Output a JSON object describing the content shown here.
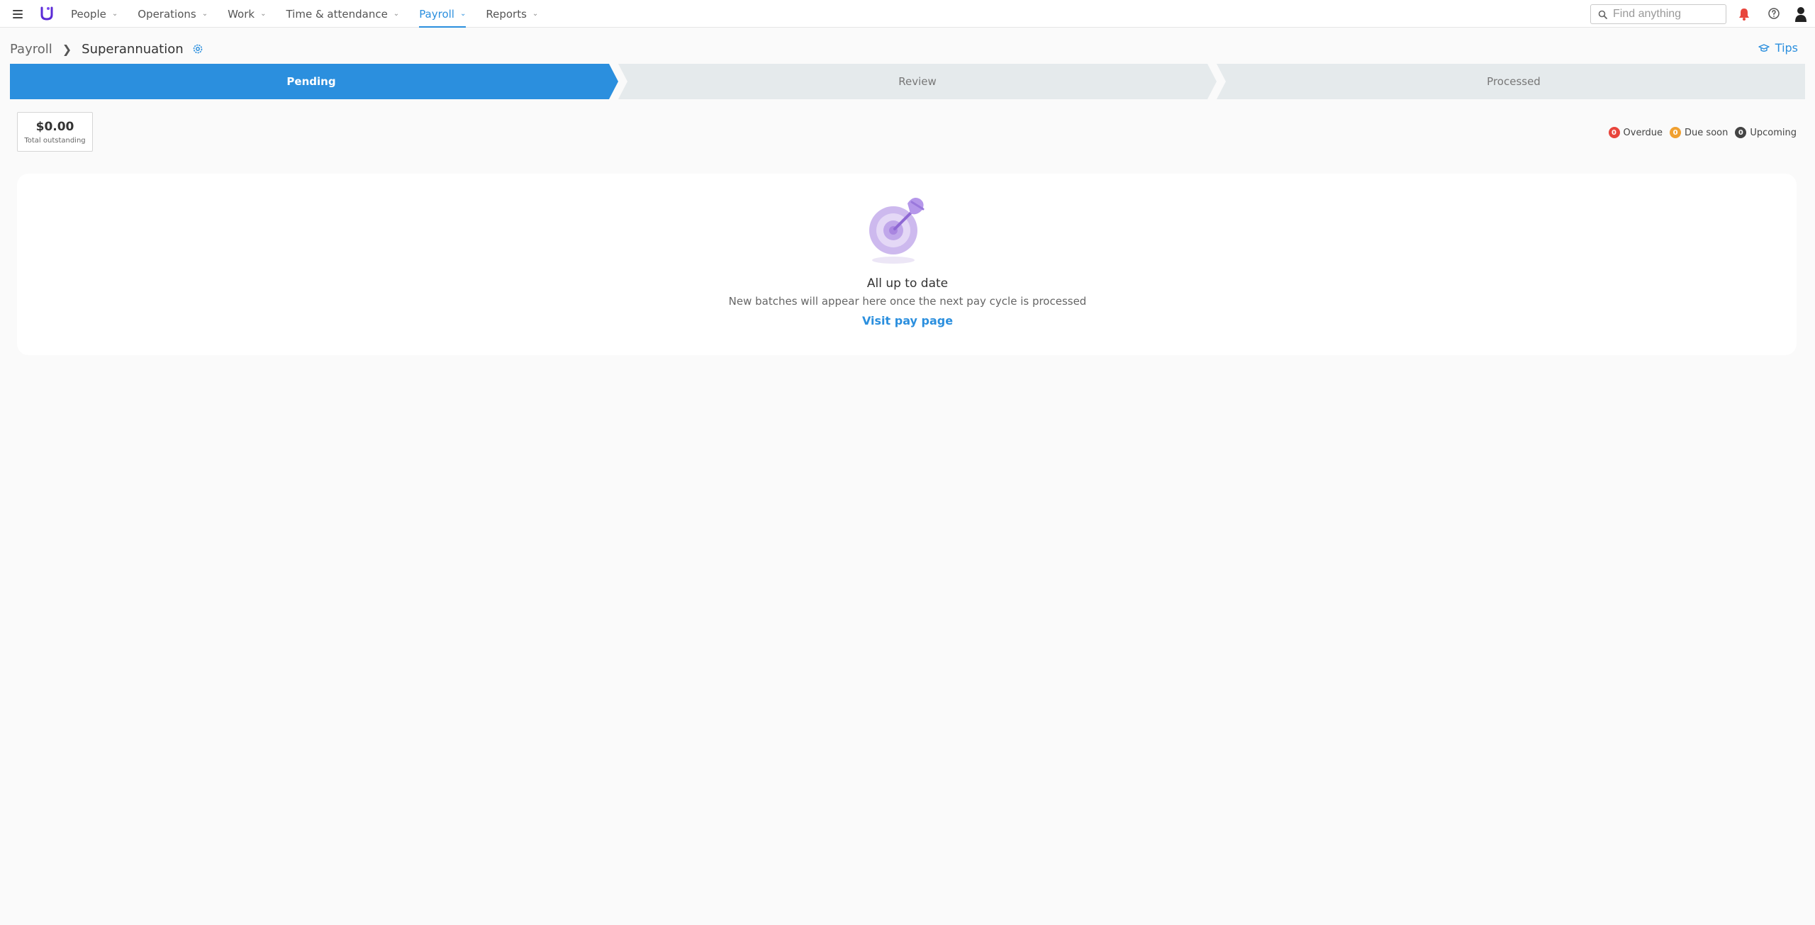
{
  "nav": {
    "items": [
      {
        "label": "People"
      },
      {
        "label": "Operations"
      },
      {
        "label": "Work"
      },
      {
        "label": "Time & attendance"
      },
      {
        "label": "Payroll",
        "active": true
      },
      {
        "label": "Reports"
      }
    ],
    "search_placeholder": "Find anything",
    "icons": [
      "menu-icon",
      "logo",
      "search-icon",
      "bell-icon",
      "help-icon",
      "user-icon"
    ]
  },
  "breadcrumb": {
    "root": "Payroll",
    "current": "Superannuation"
  },
  "tips_label": "Tips",
  "steps": [
    {
      "label": "Pending",
      "active": true
    },
    {
      "label": "Review",
      "active": false
    },
    {
      "label": "Processed",
      "active": false
    }
  ],
  "total": {
    "amount": "$0.00",
    "label": "Total outstanding"
  },
  "legend": [
    {
      "count": "0",
      "label": "Overdue",
      "color": "#e8453c"
    },
    {
      "count": "0",
      "label": "Due soon",
      "color": "#f0a030"
    },
    {
      "count": "0",
      "label": "Upcoming",
      "color": "#444444"
    }
  ],
  "empty_state": {
    "title": "All up to date",
    "subtitle": "New batches will appear here once the next pay cycle is processed",
    "link": "Visit pay page"
  },
  "colors": {
    "accent": "#2b8fde",
    "step_inactive": "#e5eaec"
  }
}
